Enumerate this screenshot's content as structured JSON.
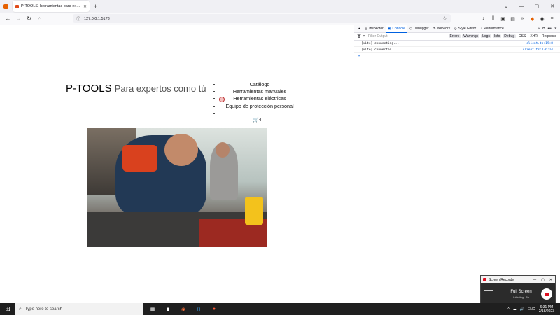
{
  "browser": {
    "tab_title": "P-TOOLS, herramientas para expertos",
    "url": "127.0.0.1:5173",
    "newtab_glyph": "+",
    "tab_close_glyph": "✕",
    "window_buttons": [
      "⌄",
      "—",
      "▢",
      "✕"
    ],
    "nav_glyphs": {
      "back": "←",
      "forward": "→",
      "reload": "↻",
      "home": "⌂",
      "shield": "ⓘ",
      "star": "☆"
    },
    "tools_glyphs": [
      "↓",
      "⫼",
      "▣",
      "▤",
      "»",
      "◆",
      "◉",
      "≡"
    ]
  },
  "page": {
    "brand": "P-TOOLS",
    "tagline": "Para expertos como tú",
    "menu": [
      "Catálogo",
      "Herramientas manuales",
      "Herramientas eléctricas",
      "Equipo de protección personal",
      ""
    ],
    "cart_icon": "🛒",
    "cart_count": "4"
  },
  "devtools": {
    "tabs": [
      {
        "icon": "◎",
        "label": "Inspector"
      },
      {
        "icon": "▣",
        "label": "Console"
      },
      {
        "icon": "◇",
        "label": "Debugger"
      },
      {
        "icon": "⇅",
        "label": "Network"
      },
      {
        "icon": "{}",
        "label": "Style Editor"
      },
      {
        "icon": "◔",
        "label": "Performance"
      }
    ],
    "right_glyphs": [
      "»",
      "⧉",
      "•••",
      "✕"
    ],
    "filter_placeholder": "Filter Output",
    "filters": [
      "Errors",
      "Warnings",
      "Logs",
      "Info",
      "Debug",
      "CSS",
      "XHR",
      "Requests"
    ],
    "logs": [
      {
        "msg": "[vite] connecting...",
        "src": "client.ts:19:8"
      },
      {
        "msg": "[vite] connected.",
        "src": "client.ts:136:14"
      }
    ],
    "prompt": "»"
  },
  "recorder": {
    "title": "Screen Recorder",
    "mode": "Full Screen",
    "status": "Initiating · 0s",
    "controls": [
      "—",
      "▢",
      "✕"
    ]
  },
  "taskbar": {
    "start_glyph": "⊞",
    "search_placeholder": "Type here to search",
    "apps": [
      "▦",
      "▮",
      "◉",
      "⟨⟩",
      "●"
    ],
    "tray": [
      "^",
      "☁",
      "🔊",
      "ENG"
    ],
    "time": "6:31 PM",
    "date": "2/18/2023"
  }
}
